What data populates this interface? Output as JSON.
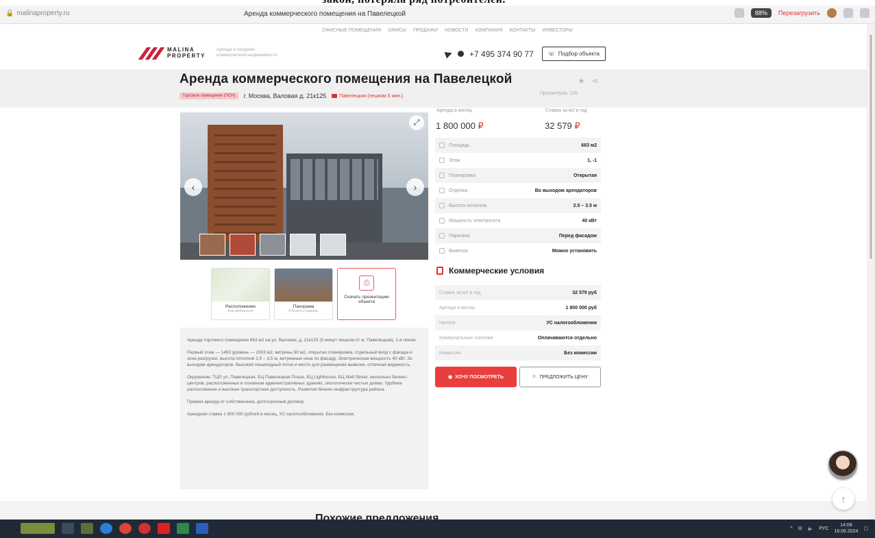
{
  "overlay_caption": "закон, потеряла ряд потребителей.",
  "browser": {
    "site": "malinaproperty.ru",
    "tab_title": "Аренда коммерческого помещения на Павелецкой",
    "badge": "88%",
    "reload_label": "Перезагрузить"
  },
  "site": {
    "top_nav": [
      "Офисные помещения",
      "Офисы",
      "Продажи",
      "Новости",
      "Компания",
      "Контакты",
      "Инвесторы"
    ],
    "logo_line1": "MALINA",
    "logo_line2": "PROPERTY",
    "logo_tag_line1": "Аренда и продажа",
    "logo_tag_line2": "коммерческой недвижимости",
    "phone": "+7 495 374 90 77",
    "submit_object_label": "Подбор объекта"
  },
  "listing": {
    "title": "Аренда коммерческого помещения на Павелецкой",
    "type_tag": "Торговое помещение (ПСН)",
    "address": "г. Москва, Валовая д. 21к125",
    "metro": "Павелецкая (пешком 5 мин.)",
    "views": "Просмотров: 120"
  },
  "gallery": {
    "prev_icon": "‹",
    "next_icon": "›",
    "expand_icon": "⤢"
  },
  "cards": [
    {
      "label": "Расположение",
      "sub": "Как добраться"
    },
    {
      "label": "Панорама",
      "sub": "Объекта недвиж."
    },
    {
      "label": "Скачать презентацию объекта"
    }
  ],
  "description": [
    "Аренда торгового помещения 663 м2 на ул. Валовая, д. 21к125 (5 минут пешком от м. Павелецкая), 1-я линия.",
    "Первый этаж — 1463 уровень — 2003 м2, витрины 90 м2, открытая планировка, отдельный вход с фасада и зона разгрузки, высота потолков 2,5 – 3,5 м, витринные окна по фасаду. Электрическая мощность 40 кВт. Зо выходом арендаторов. Высокий пешеходный поток и место для размещения вывески, отличная видимость.",
    "Окружение: ТЦР, ул. Павелецкая, БЦ Павелецкая Плаза, БЦ Lighthouse, БЦ Well Street, несколько бизнес-центров, расположенных в основном административных зданиях, экологически чистых домах. Удобное расположение и высокая транспортная доступность. Развитая бизнес-инфраструктура района.",
    "Прямая аренда от собственника, долгосрочный договор.",
    "Арендная ставка 1 800 000 рублей в месяц, УС налогообложения. Без комиссии."
  ],
  "pricing": {
    "month_label": "Аренда в месяц",
    "month_value": "1 800 000",
    "rate_label": "Ставка за м2 в год",
    "rate_value": "32 579",
    "currency": "₽"
  },
  "specs": [
    {
      "key": "Площадь",
      "value": "663 м2"
    },
    {
      "key": "Этаж",
      "value": "1, -1"
    },
    {
      "key": "Планировка",
      "value": "Открытая"
    },
    {
      "key": "Отделка",
      "value": "Во выходом арендаторов"
    },
    {
      "key": "Высота потолков",
      "value": "2.5 – 3.5 м"
    },
    {
      "key": "Мощность электросети",
      "value": "40 кВт"
    },
    {
      "key": "Парковка",
      "value": "Перед фасадом"
    },
    {
      "key": "Вывески",
      "value": "Можно установить"
    }
  ],
  "conditions": {
    "title": "Коммерческие условия",
    "rows": [
      {
        "key": "Ставка за м2 в год",
        "value": "32 579 руб"
      },
      {
        "key": "Аренда в месяц",
        "value": "1 800 000 руб"
      },
      {
        "key": "Налоги",
        "value": "УС налогообложения"
      },
      {
        "key": "Коммунальные платежи",
        "value": "Оплачиваются отдельно"
      },
      {
        "key": "Комиссия",
        "value": "Без комиссии"
      }
    ]
  },
  "cta": {
    "view_label": "ХОЧУ ПОСМОТРЕТЬ",
    "offer_label": "ПРЕДЛОЖИТЬ ЦЕНУ"
  },
  "similar_heading": "Похожие предложения",
  "taskbar": {
    "lang": "РУС",
    "time": "14:08",
    "date": "18.06.2024"
  },
  "colors": {
    "accent": "#ea3d3d",
    "brand": "#c8243b"
  }
}
